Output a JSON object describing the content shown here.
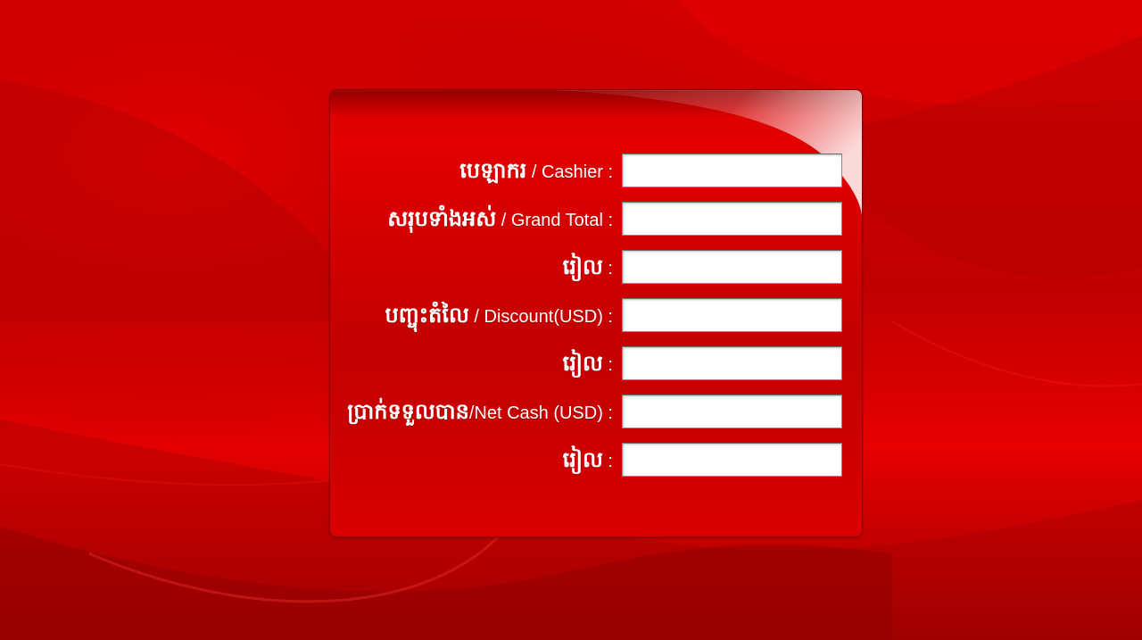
{
  "theme": {
    "background": "#d30000",
    "panel": "#c80000",
    "text": "#ffffff",
    "field": "#ffffff"
  },
  "form": {
    "rows": [
      {
        "km": "បេឡាករ",
        "en": " / Cashier :",
        "value": ""
      },
      {
        "km": "សរុបទាំងអស់",
        "en": " / Grand Total :",
        "value": ""
      },
      {
        "km": "រៀល",
        "en": " :",
        "value": ""
      },
      {
        "km": "បញ្ចុះតំលៃ",
        "en": " / Discount(USD) :",
        "value": ""
      },
      {
        "km": "រៀល",
        "en": " :",
        "value": ""
      },
      {
        "km": "ប្រាក់ទទួលបាន",
        "en": "/Net Cash (USD) :",
        "value": ""
      },
      {
        "km": "រៀល",
        "en": " :",
        "value": ""
      }
    ]
  }
}
